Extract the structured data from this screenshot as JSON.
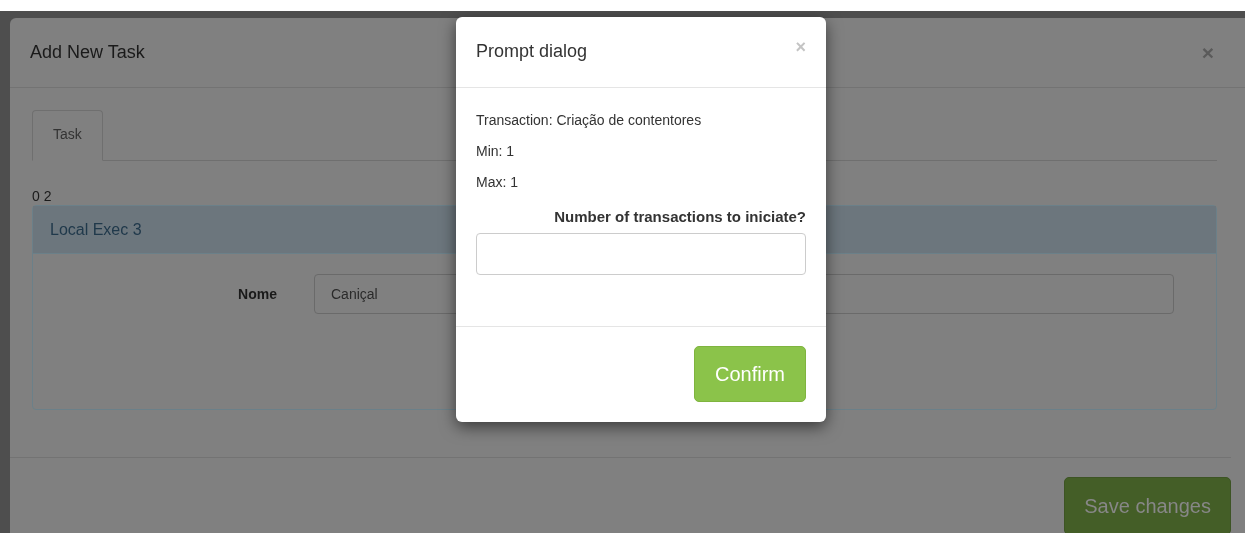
{
  "background_modal": {
    "title": "Add New Task",
    "close": "×",
    "tabs": [
      {
        "label": "Task",
        "selected": true
      }
    ],
    "counter": "0 2",
    "panel": {
      "title": "Local Exec 3",
      "fields": [
        {
          "label": "Nome",
          "value": "Caniçal"
        }
      ]
    },
    "buttons": [
      "Save changes"
    ]
  },
  "prompt_dialog": {
    "title": "Prompt dialog",
    "close": "×",
    "lines": [
      "Transaction: Criação de contentores",
      "Min: 1",
      "Max: 1"
    ],
    "question": "Number of transactions to iniciate?",
    "buttons": [
      "Confirm"
    ]
  }
}
